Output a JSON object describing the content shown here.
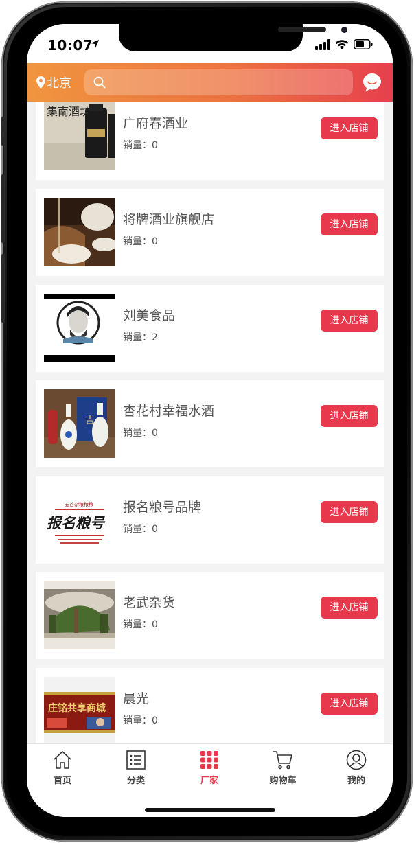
{
  "status_bar": {
    "time": "10:07"
  },
  "header": {
    "city": "北京",
    "search_placeholder": ""
  },
  "stores": [
    {
      "name": "广府春酒业",
      "sales_label": "销量：",
      "sales": "0",
      "button": "进入店铺",
      "thumb": "baijiu-bottle"
    },
    {
      "name": "将牌酒业旗舰店",
      "sales_label": "销量：",
      "sales": "0",
      "button": "进入店铺",
      "thumb": "wine-pour"
    },
    {
      "name": "刘美食品",
      "sales_label": "销量：",
      "sales": "2",
      "button": "进入店铺",
      "thumb": "portrait-logo"
    },
    {
      "name": "杏花村幸福水酒",
      "sales_label": "销量：",
      "sales": "0",
      "button": "进入店铺",
      "thumb": "porcelain-bottles"
    },
    {
      "name": "报名粮号品牌",
      "sales_label": "销量：",
      "sales": "0",
      "button": "进入店铺",
      "thumb": "calligraphy-brand"
    },
    {
      "name": "老武杂货",
      "sales_label": "销量：",
      "sales": "0",
      "button": "进入店铺",
      "thumb": "interior-garden"
    },
    {
      "name": "晨光",
      "sales_label": "销量：",
      "sales": "0",
      "button": "进入店铺",
      "thumb": "mall-banner"
    }
  ],
  "thumb_texts": {
    "store1_calligraphy": "集南酒坊",
    "store4_label": "吉",
    "store5_top": "五谷杂粮粮粮",
    "store5_main": "报名粮号",
    "store7_banner": "庄铭共享商城"
  },
  "tabs": [
    {
      "label": "首页",
      "icon": "home-icon",
      "active": false
    },
    {
      "label": "分类",
      "icon": "list-icon",
      "active": false
    },
    {
      "label": "厂家",
      "icon": "grid-icon",
      "active": true
    },
    {
      "label": "购物车",
      "icon": "cart-icon",
      "active": false
    },
    {
      "label": "我的",
      "icon": "user-icon",
      "active": false
    }
  ],
  "colors": {
    "accent": "#e8384c",
    "header_start": "#f0953f",
    "header_end": "#e6404d",
    "background": "#f3f3f3"
  }
}
